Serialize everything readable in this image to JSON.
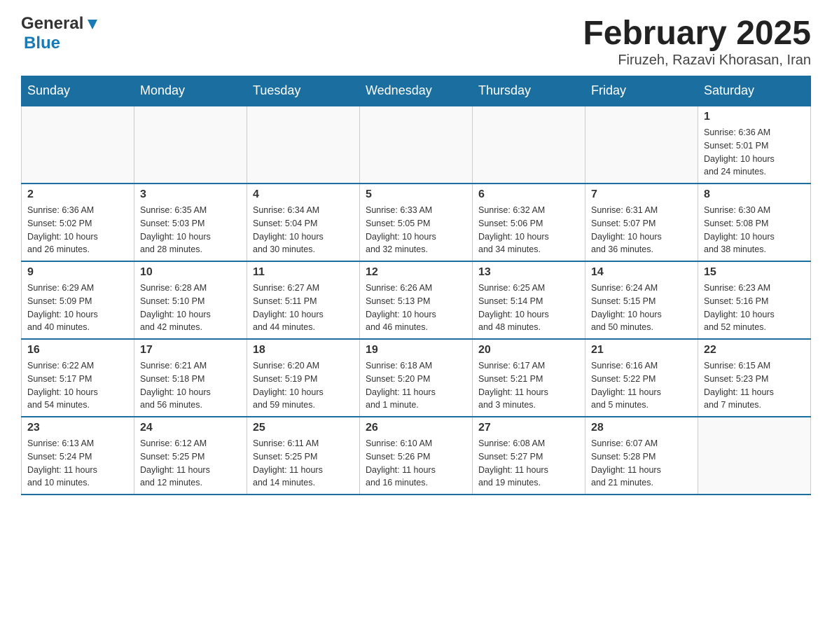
{
  "header": {
    "logo_general": "General",
    "logo_blue": "Blue",
    "title": "February 2025",
    "subtitle": "Firuzeh, Razavi Khorasan, Iran"
  },
  "weekdays": [
    "Sunday",
    "Monday",
    "Tuesday",
    "Wednesday",
    "Thursday",
    "Friday",
    "Saturday"
  ],
  "weeks": [
    [
      {
        "day": "",
        "info": ""
      },
      {
        "day": "",
        "info": ""
      },
      {
        "day": "",
        "info": ""
      },
      {
        "day": "",
        "info": ""
      },
      {
        "day": "",
        "info": ""
      },
      {
        "day": "",
        "info": ""
      },
      {
        "day": "1",
        "info": "Sunrise: 6:36 AM\nSunset: 5:01 PM\nDaylight: 10 hours\nand 24 minutes."
      }
    ],
    [
      {
        "day": "2",
        "info": "Sunrise: 6:36 AM\nSunset: 5:02 PM\nDaylight: 10 hours\nand 26 minutes."
      },
      {
        "day": "3",
        "info": "Sunrise: 6:35 AM\nSunset: 5:03 PM\nDaylight: 10 hours\nand 28 minutes."
      },
      {
        "day": "4",
        "info": "Sunrise: 6:34 AM\nSunset: 5:04 PM\nDaylight: 10 hours\nand 30 minutes."
      },
      {
        "day": "5",
        "info": "Sunrise: 6:33 AM\nSunset: 5:05 PM\nDaylight: 10 hours\nand 32 minutes."
      },
      {
        "day": "6",
        "info": "Sunrise: 6:32 AM\nSunset: 5:06 PM\nDaylight: 10 hours\nand 34 minutes."
      },
      {
        "day": "7",
        "info": "Sunrise: 6:31 AM\nSunset: 5:07 PM\nDaylight: 10 hours\nand 36 minutes."
      },
      {
        "day": "8",
        "info": "Sunrise: 6:30 AM\nSunset: 5:08 PM\nDaylight: 10 hours\nand 38 minutes."
      }
    ],
    [
      {
        "day": "9",
        "info": "Sunrise: 6:29 AM\nSunset: 5:09 PM\nDaylight: 10 hours\nand 40 minutes."
      },
      {
        "day": "10",
        "info": "Sunrise: 6:28 AM\nSunset: 5:10 PM\nDaylight: 10 hours\nand 42 minutes."
      },
      {
        "day": "11",
        "info": "Sunrise: 6:27 AM\nSunset: 5:11 PM\nDaylight: 10 hours\nand 44 minutes."
      },
      {
        "day": "12",
        "info": "Sunrise: 6:26 AM\nSunset: 5:13 PM\nDaylight: 10 hours\nand 46 minutes."
      },
      {
        "day": "13",
        "info": "Sunrise: 6:25 AM\nSunset: 5:14 PM\nDaylight: 10 hours\nand 48 minutes."
      },
      {
        "day": "14",
        "info": "Sunrise: 6:24 AM\nSunset: 5:15 PM\nDaylight: 10 hours\nand 50 minutes."
      },
      {
        "day": "15",
        "info": "Sunrise: 6:23 AM\nSunset: 5:16 PM\nDaylight: 10 hours\nand 52 minutes."
      }
    ],
    [
      {
        "day": "16",
        "info": "Sunrise: 6:22 AM\nSunset: 5:17 PM\nDaylight: 10 hours\nand 54 minutes."
      },
      {
        "day": "17",
        "info": "Sunrise: 6:21 AM\nSunset: 5:18 PM\nDaylight: 10 hours\nand 56 minutes."
      },
      {
        "day": "18",
        "info": "Sunrise: 6:20 AM\nSunset: 5:19 PM\nDaylight: 10 hours\nand 59 minutes."
      },
      {
        "day": "19",
        "info": "Sunrise: 6:18 AM\nSunset: 5:20 PM\nDaylight: 11 hours\nand 1 minute."
      },
      {
        "day": "20",
        "info": "Sunrise: 6:17 AM\nSunset: 5:21 PM\nDaylight: 11 hours\nand 3 minutes."
      },
      {
        "day": "21",
        "info": "Sunrise: 6:16 AM\nSunset: 5:22 PM\nDaylight: 11 hours\nand 5 minutes."
      },
      {
        "day": "22",
        "info": "Sunrise: 6:15 AM\nSunset: 5:23 PM\nDaylight: 11 hours\nand 7 minutes."
      }
    ],
    [
      {
        "day": "23",
        "info": "Sunrise: 6:13 AM\nSunset: 5:24 PM\nDaylight: 11 hours\nand 10 minutes."
      },
      {
        "day": "24",
        "info": "Sunrise: 6:12 AM\nSunset: 5:25 PM\nDaylight: 11 hours\nand 12 minutes."
      },
      {
        "day": "25",
        "info": "Sunrise: 6:11 AM\nSunset: 5:25 PM\nDaylight: 11 hours\nand 14 minutes."
      },
      {
        "day": "26",
        "info": "Sunrise: 6:10 AM\nSunset: 5:26 PM\nDaylight: 11 hours\nand 16 minutes."
      },
      {
        "day": "27",
        "info": "Sunrise: 6:08 AM\nSunset: 5:27 PM\nDaylight: 11 hours\nand 19 minutes."
      },
      {
        "day": "28",
        "info": "Sunrise: 6:07 AM\nSunset: 5:28 PM\nDaylight: 11 hours\nand 21 minutes."
      },
      {
        "day": "",
        "info": ""
      }
    ]
  ]
}
